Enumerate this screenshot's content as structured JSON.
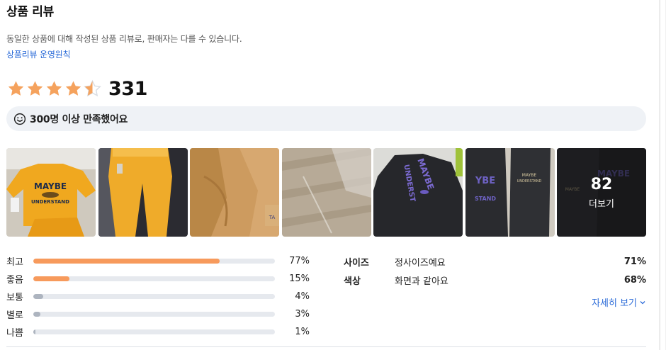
{
  "section_title": "상품 리뷰",
  "notice": "동일한 상품에 대해 작성된 상품 리뷰로, 판매자는 다를 수 있습니다.",
  "policy_link": "상품리뷰 운영원칙",
  "rating": {
    "stars": 4.5,
    "max": 5,
    "count": "331",
    "star_color": "#f5a25d",
    "star_empty_color": "#d9dde3"
  },
  "satisfaction": {
    "icon": "smile-icon",
    "text": "300명 이상 만족했어요"
  },
  "photos": [
    {
      "name": "photo-yellow-sweatshirt-set"
    },
    {
      "name": "photo-yellow-sweatpants"
    },
    {
      "name": "photo-tan-fabric-closeup"
    },
    {
      "name": "photo-wooden-floor-package"
    },
    {
      "name": "photo-black-hoodie-purple-print"
    },
    {
      "name": "photo-black-set-laid-out"
    },
    {
      "name": "photo-black-set-more",
      "more_count": "82",
      "more_label": "더보기"
    }
  ],
  "distribution": [
    {
      "label": "최고",
      "pct": "77%",
      "value": 0.77,
      "color": "#f79a5c"
    },
    {
      "label": "좋음",
      "pct": "15%",
      "value": 0.15,
      "color": "#f79a5c"
    },
    {
      "label": "보통",
      "pct": "4%",
      "value": 0.04,
      "color": "#adb4bf"
    },
    {
      "label": "별로",
      "pct": "3%",
      "value": 0.03,
      "color": "#adb4bf"
    },
    {
      "label": "나쁨",
      "pct": "1%",
      "value": 0.01,
      "color": "#adb4bf"
    }
  ],
  "attributes": [
    {
      "name": "사이즈",
      "value": "정사이즈예요",
      "pct": "71%"
    },
    {
      "name": "색상",
      "value": "화면과 같아요",
      "pct": "68%"
    }
  ],
  "detail_link": "자세히 보기",
  "colors": {
    "link": "#2b6bd8",
    "bar_track": "#e6e9ee",
    "satisfaction_bg": "#eff2f6"
  }
}
